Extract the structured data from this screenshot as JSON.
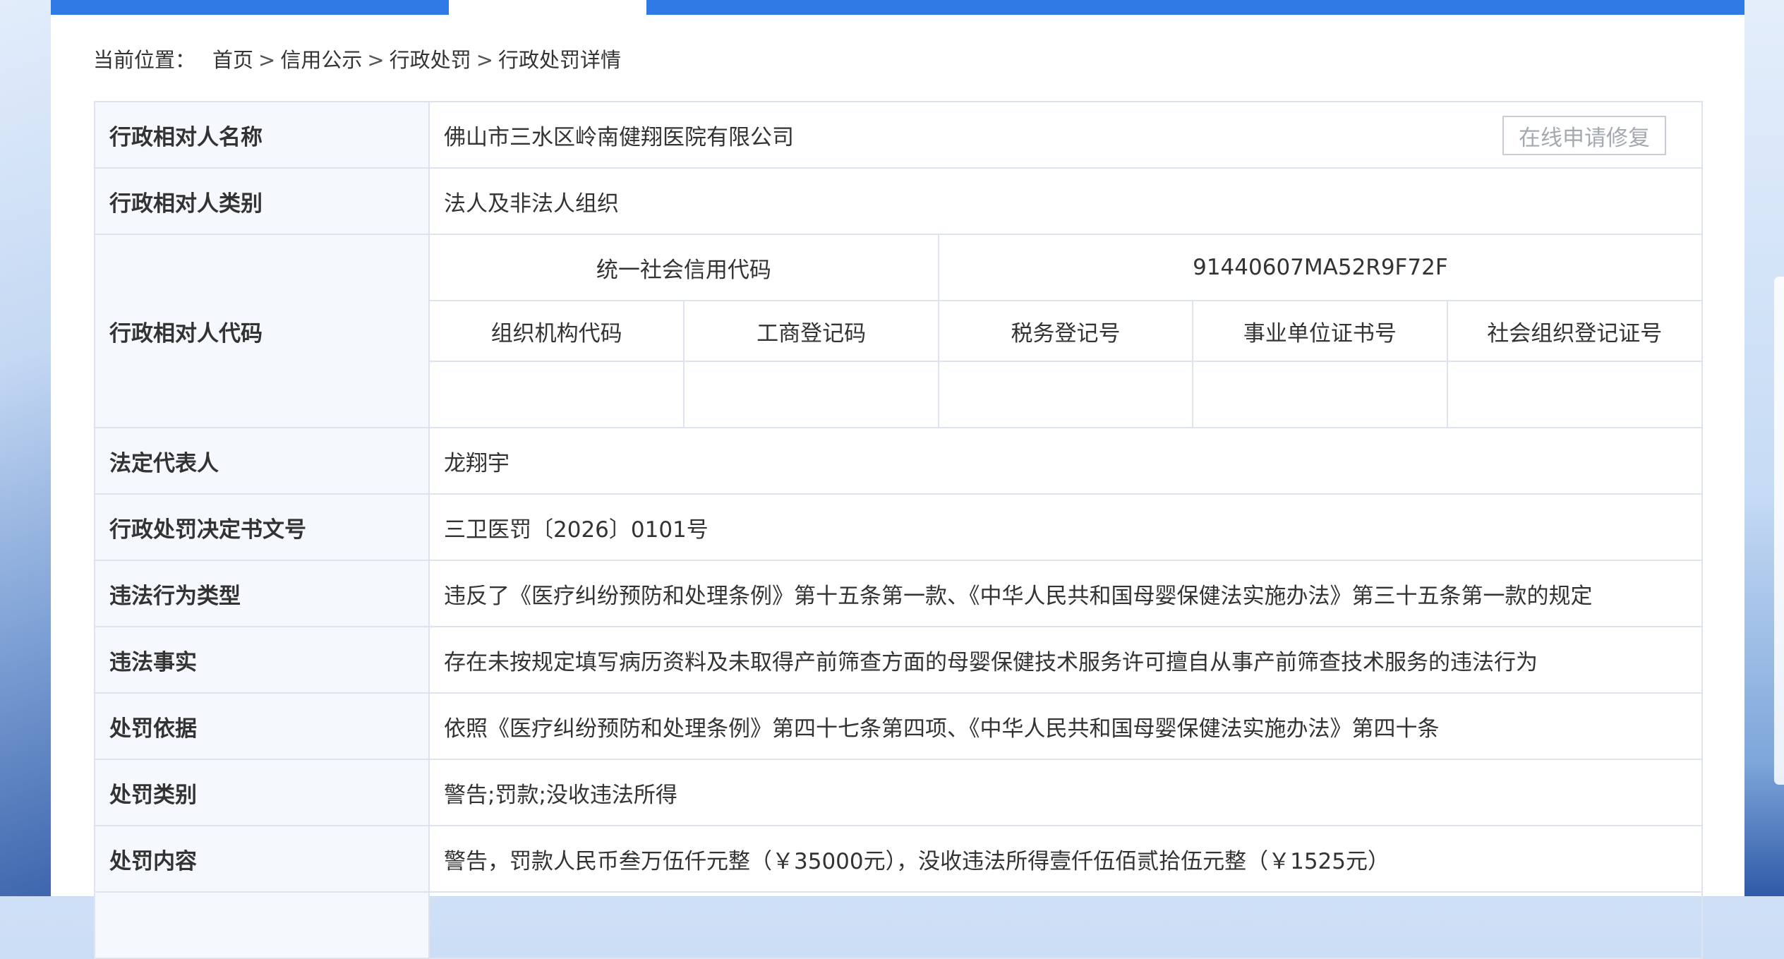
{
  "breadcrumb": {
    "prefix": "当前位置：",
    "items": [
      "首页",
      "信用公示",
      "行政处罚",
      "行政处罚详情"
    ],
    "separator": ">"
  },
  "repair_button": "在线申请修复",
  "labels": {
    "name": "行政相对人名称",
    "category": "行政相对人类别",
    "code": "行政相对人代码",
    "legal_rep": "法定代表人",
    "decision_no": "行政处罚决定书文号",
    "violation_type": "违法行为类型",
    "violation_fact": "违法事实",
    "basis": "处罚依据",
    "penalty_type": "处罚类别",
    "penalty_content": "处罚内容"
  },
  "values": {
    "name": "佛山市三水区岭南健翔医院有限公司",
    "category": "法人及非法人组织",
    "legal_rep": "龙翔宇",
    "decision_no": "三卫医罚〔2026〕0101号",
    "violation_type": "违反了《医疗纠纷预防和处理条例》第十五条第一款、《中华人民共和国母婴保健法实施办法》第三十五条第一款的规定",
    "violation_fact": "存在未按规定填写病历资料及未取得产前筛查方面的母婴保健技术服务许可擅自从事产前筛查技术服务的违法行为",
    "basis": "依照《医疗纠纷预防和处理条例》第四十七条第四项、《中华人民共和国母婴保健法实施办法》第四十条",
    "penalty_type": "警告;罚款;没收违法所得",
    "penalty_content": "警告，罚款人民币叁万伍仟元整（￥35000元），没收违法所得壹仟伍佰贰拾伍元整（￥1525元）"
  },
  "codes": {
    "usc_label": "统一社会信用代码",
    "usc_value": "91440607MA52R9F72F",
    "columns": [
      "组织机构代码",
      "工商登记码",
      "税务登记号",
      "事业单位证书号",
      "社会组织登记证号"
    ],
    "values": [
      "",
      "",
      "",
      "",
      ""
    ]
  },
  "colors": {
    "tab_bar": "#2f7ae5",
    "label_bg": "#f5f8fd",
    "border": "#dde4ee"
  }
}
